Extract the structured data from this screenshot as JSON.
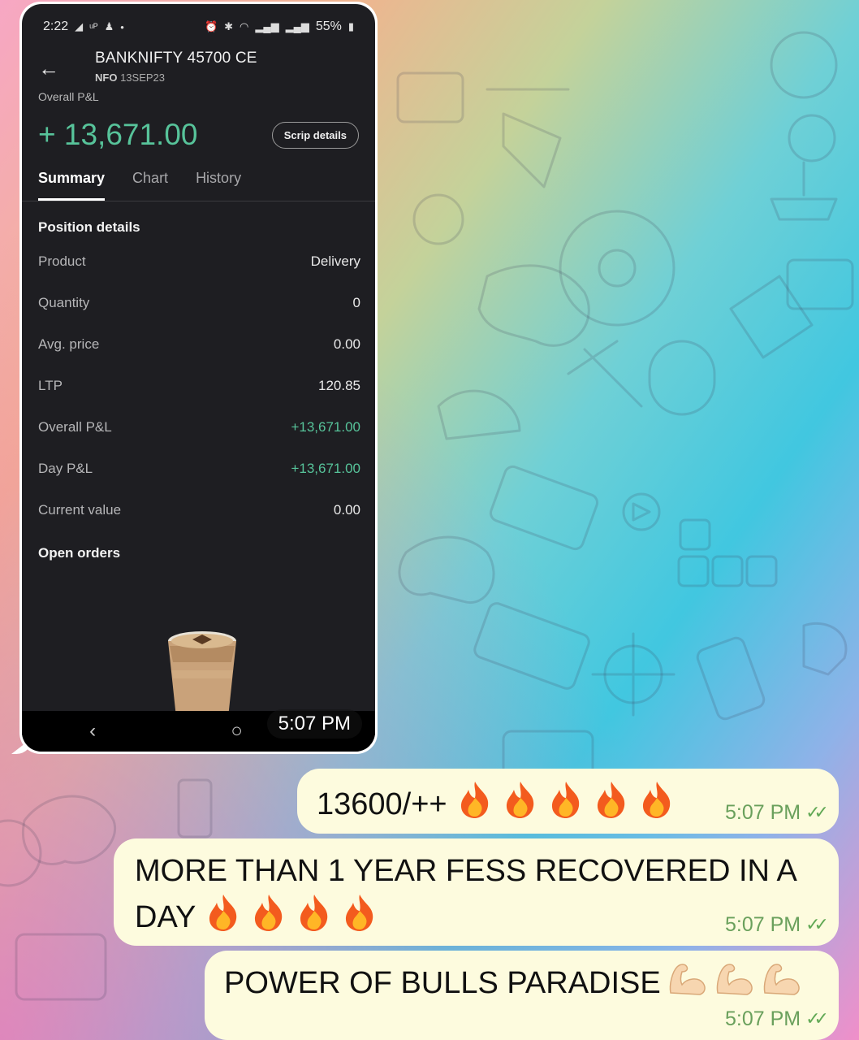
{
  "status_bar": {
    "time": "2:22",
    "battery": "55%"
  },
  "header": {
    "title": "BANKNIFTY 45700 CE",
    "exchange": "NFO",
    "expiry": "13SEP23",
    "overall_label": "Overall P&L",
    "pnl_value": "+ 13,671.00",
    "scrip_button": "Scrip details"
  },
  "tabs": [
    {
      "label": "Summary",
      "active": true
    },
    {
      "label": "Chart",
      "active": false
    },
    {
      "label": "History",
      "active": false
    }
  ],
  "position": {
    "section_title": "Position details",
    "rows": [
      {
        "key": "Product",
        "value": "Delivery",
        "green": false
      },
      {
        "key": "Quantity",
        "value": "0",
        "green": false
      },
      {
        "key": "Avg. price",
        "value": "0.00",
        "green": false
      },
      {
        "key": "LTP",
        "value": "120.85",
        "green": false
      },
      {
        "key": "Overall P&L",
        "value": "+13,671.00",
        "green": true
      },
      {
        "key": "Day P&L",
        "value": "+13,671.00",
        "green": true
      },
      {
        "key": "Current value",
        "value": "0.00",
        "green": false
      }
    ],
    "open_orders_title": "Open orders"
  },
  "image_time": "5:07 PM",
  "messages": [
    {
      "text": "13600/++",
      "emoji_count": 5,
      "emoji": "fire",
      "time": "5:07 PM"
    },
    {
      "text": "MORE THAN 1  YEAR FESS RECOVERED IN A DAY",
      "emoji_count": 4,
      "emoji": "fire",
      "time": "5:07 PM"
    },
    {
      "text": "POWER OF BULLS PARADISE",
      "emoji_count": 3,
      "emoji": "flexed-biceps",
      "time": "5:07 PM"
    }
  ],
  "colors": {
    "profit_green": "#57c39a",
    "bubble_out": "#fdfbde",
    "app_bg": "#1e1e22",
    "tick_green": "#62a956"
  }
}
